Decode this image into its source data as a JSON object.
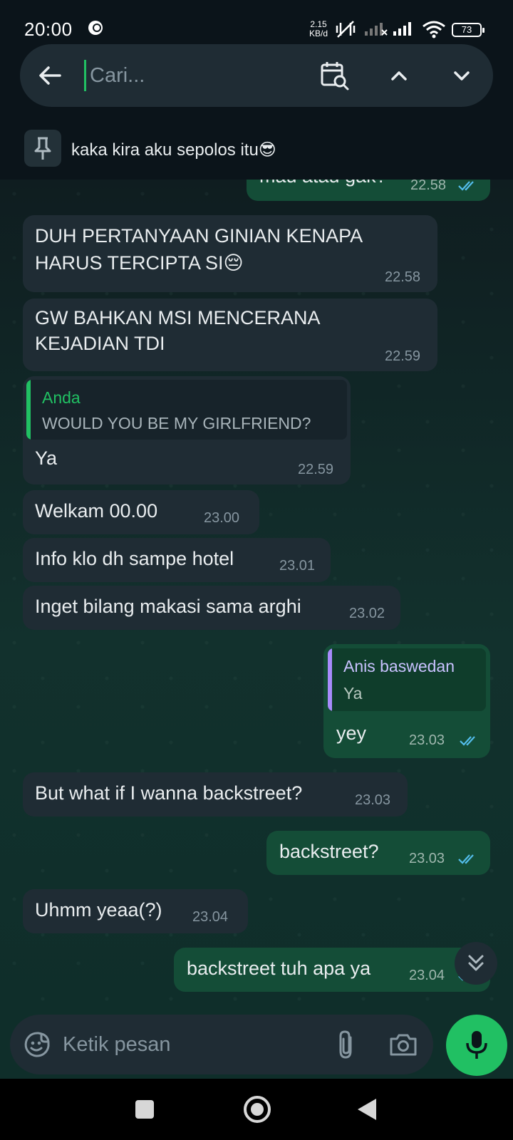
{
  "status_bar": {
    "time": "20:00",
    "net_speed_value": "2.15",
    "net_speed_unit": "KB/d",
    "battery": "73"
  },
  "search": {
    "placeholder": "Cari..."
  },
  "pinned": {
    "text": "kaka kira aku sepolos itu😎"
  },
  "messages": [
    {
      "dir": "out",
      "text": "mau atau gak?",
      "time": "22.58"
    },
    {
      "dir": "in",
      "lines": [
        "DUH PERTANYAAN GINIAN KENAPA",
        "HARUS TERCIPTA SI😔"
      ],
      "time": "22.58"
    },
    {
      "dir": "in",
      "lines": [
        "GW BAHKAN MSI MENCERANA",
        "KEJADIAN TDI"
      ],
      "time": "22.59"
    },
    {
      "dir": "in",
      "quote_name": "Anda",
      "quote_text": "WOULD YOU BE MY GIRLFRIEND?",
      "text": "Ya",
      "time": "22.59"
    },
    {
      "dir": "in",
      "text": "Welkam 00.00",
      "time": "23.00"
    },
    {
      "dir": "in",
      "text": "Info klo dh sampe hotel",
      "time": "23.01"
    },
    {
      "dir": "in",
      "text": "Inget bilang makasi sama arghi",
      "time": "23.02"
    },
    {
      "dir": "out",
      "quote_name": "Anis baswedan",
      "quote_text": "Ya",
      "text": "yey",
      "time": "23.03"
    },
    {
      "dir": "in",
      "text": "But what if I wanna backstreet?",
      "time": "23.03"
    },
    {
      "dir": "out",
      "text": "backstreet?",
      "time": "23.03"
    },
    {
      "dir": "in",
      "text": "Uhmm yeaa(?)",
      "time": "23.04"
    },
    {
      "dir": "out",
      "text": "backstreet tuh apa ya",
      "time": "23.04"
    }
  ],
  "composer": {
    "placeholder": "Ketik pesan"
  },
  "colors": {
    "accent_green": "#21c063",
    "incoming_bubble": "#1f2c34",
    "outgoing_bubble": "#144d37",
    "read_tick": "#53bdeb",
    "quote_self_bar": "#21c063",
    "quote_other_bar": "#a78bfa"
  }
}
